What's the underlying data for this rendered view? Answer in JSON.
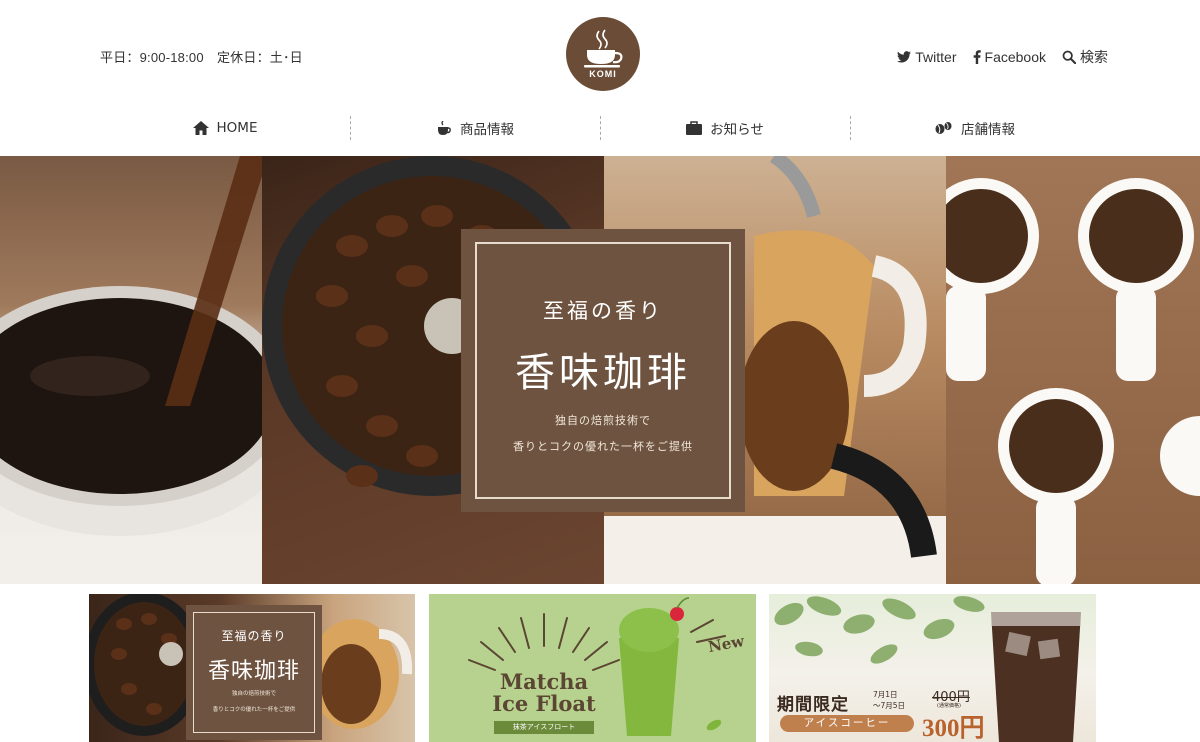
{
  "header": {
    "hours": "平日：9:00-18:00　定休日：土･日",
    "logo_text": "KOMI",
    "social": [
      {
        "label": "Twitter",
        "icon": "twitter-icon"
      },
      {
        "label": "Facebook",
        "icon": "facebook-icon"
      },
      {
        "label": "検索",
        "icon": "search-icon"
      }
    ]
  },
  "nav": [
    {
      "label": "HOME",
      "icon": "home-icon"
    },
    {
      "label": "商品情報",
      "icon": "cup-icon"
    },
    {
      "label": "お知らせ",
      "icon": "bag-icon"
    },
    {
      "label": "店舗情報",
      "icon": "beans-icon"
    }
  ],
  "hero": {
    "subtitle": "至福の香り",
    "title": "香味珈琲",
    "desc_line1": "独自の焙煎技術で",
    "desc_line2": "香りとコクの優れた一杯をご提供"
  },
  "banners": {
    "b1": {
      "subtitle": "至福の香り",
      "title": "香味珈琲",
      "desc_line1": "独自の焙煎技術で",
      "desc_line2": "香りとコクの優れた一杯をご提供"
    },
    "b2": {
      "title_line1": "Matcha",
      "title_line2": "Ice Float",
      "sub": "抹茶アイスフロート",
      "badge": "New"
    },
    "b3": {
      "heading": "期間限定",
      "date_line1": "7月1日",
      "date_line2": "～7月5日",
      "old_price": "400円",
      "old_note": "(通常価格)",
      "product": "アイスコーヒー",
      "price": "300円"
    }
  },
  "colors": {
    "brand_brown": "#6e5440",
    "logo_brown": "#6b4c36",
    "matcha_green": "#b7d28f",
    "price_orange": "#b8622e"
  }
}
